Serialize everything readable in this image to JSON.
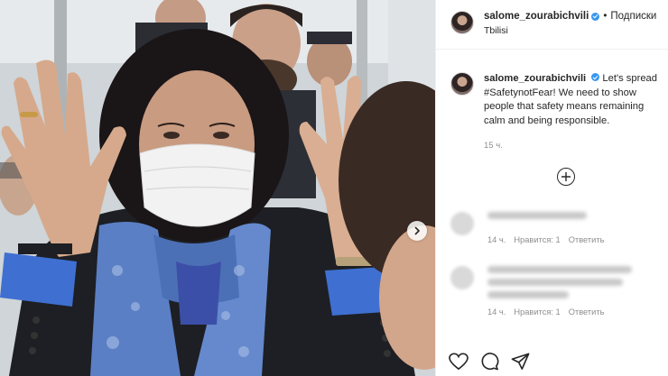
{
  "header": {
    "username": "salome_zourabichvili",
    "separator": "•",
    "follow_label": "Подписки",
    "location": "Tbilisi"
  },
  "caption": {
    "username": "salome_zourabichvili",
    "text": "Let's spread #SafetynotFear! We need to show people that safety means remaining calm and being responsible.",
    "time": "15 ч."
  },
  "comments": [
    {
      "time": "14 ч.",
      "likes": "Нравится: 1",
      "reply": "Ответить"
    },
    {
      "time": "14 ч.",
      "likes": "Нравится: 1",
      "reply": "Ответить"
    }
  ],
  "icons": {
    "verified": "verified-badge-icon",
    "load_more": "plus-circle-icon",
    "like": "heart-icon",
    "comment": "speech-bubble-icon",
    "share": "paper-plane-icon",
    "next": "chevron-right-icon"
  },
  "colors": {
    "verified_blue": "#3897f0",
    "text": "#262626",
    "muted": "#8e8e8e",
    "scarf_blue": "#5b7fc4",
    "cuff_blue": "#3f6fd1"
  }
}
